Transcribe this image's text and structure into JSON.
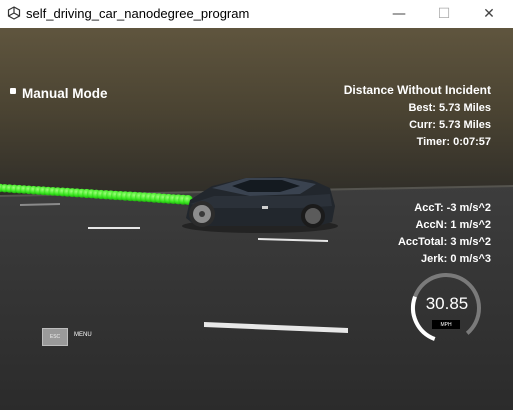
{
  "window": {
    "title": "self_driving_car_nanodegree_program",
    "minimize_glyph": "—",
    "maximize_glyph": "☐",
    "close_glyph": "✕"
  },
  "hud": {
    "mode": "Manual Mode",
    "distance_title": "Distance Without Incident",
    "best": "Best: 5.73 Miles",
    "curr": "Curr: 5.73 Miles",
    "timer": "Timer: 0:07:57",
    "acc_t": "AccT: -3 m/s^2",
    "acc_n": "AccN: 1 m/s^2",
    "acc_total": "AccTotal: 3 m/s^2",
    "jerk": "Jerk: 0 m/s^3",
    "speed": "30.85",
    "speed_unit": "MPH",
    "speed_fraction": 0.3
  },
  "menu": {
    "button_text": "ESC",
    "label": "MENU"
  },
  "colors": {
    "path": "#39e61f",
    "hud_text": "#ffffff",
    "gauge": "#ffffff",
    "gauge_track": "#7a7a7a"
  }
}
